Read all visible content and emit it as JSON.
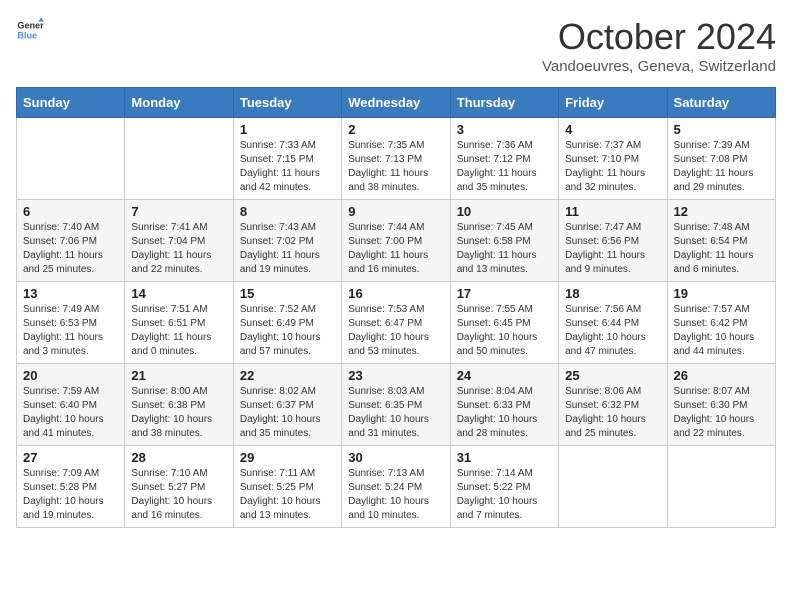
{
  "logo": {
    "line1": "General",
    "line2": "Blue"
  },
  "title": "October 2024",
  "subtitle": "Vandoeuvres, Geneva, Switzerland",
  "days_of_week": [
    "Sunday",
    "Monday",
    "Tuesday",
    "Wednesday",
    "Thursday",
    "Friday",
    "Saturday"
  ],
  "weeks": [
    [
      {
        "day": "",
        "sunrise": "",
        "sunset": "",
        "daylight": ""
      },
      {
        "day": "",
        "sunrise": "",
        "sunset": "",
        "daylight": ""
      },
      {
        "day": "1",
        "sunrise": "Sunrise: 7:33 AM",
        "sunset": "Sunset: 7:15 PM",
        "daylight": "Daylight: 11 hours and 42 minutes."
      },
      {
        "day": "2",
        "sunrise": "Sunrise: 7:35 AM",
        "sunset": "Sunset: 7:13 PM",
        "daylight": "Daylight: 11 hours and 38 minutes."
      },
      {
        "day": "3",
        "sunrise": "Sunrise: 7:36 AM",
        "sunset": "Sunset: 7:12 PM",
        "daylight": "Daylight: 11 hours and 35 minutes."
      },
      {
        "day": "4",
        "sunrise": "Sunrise: 7:37 AM",
        "sunset": "Sunset: 7:10 PM",
        "daylight": "Daylight: 11 hours and 32 minutes."
      },
      {
        "day": "5",
        "sunrise": "Sunrise: 7:39 AM",
        "sunset": "Sunset: 7:08 PM",
        "daylight": "Daylight: 11 hours and 29 minutes."
      }
    ],
    [
      {
        "day": "6",
        "sunrise": "Sunrise: 7:40 AM",
        "sunset": "Sunset: 7:06 PM",
        "daylight": "Daylight: 11 hours and 25 minutes."
      },
      {
        "day": "7",
        "sunrise": "Sunrise: 7:41 AM",
        "sunset": "Sunset: 7:04 PM",
        "daylight": "Daylight: 11 hours and 22 minutes."
      },
      {
        "day": "8",
        "sunrise": "Sunrise: 7:43 AM",
        "sunset": "Sunset: 7:02 PM",
        "daylight": "Daylight: 11 hours and 19 minutes."
      },
      {
        "day": "9",
        "sunrise": "Sunrise: 7:44 AM",
        "sunset": "Sunset: 7:00 PM",
        "daylight": "Daylight: 11 hours and 16 minutes."
      },
      {
        "day": "10",
        "sunrise": "Sunrise: 7:45 AM",
        "sunset": "Sunset: 6:58 PM",
        "daylight": "Daylight: 11 hours and 13 minutes."
      },
      {
        "day": "11",
        "sunrise": "Sunrise: 7:47 AM",
        "sunset": "Sunset: 6:56 PM",
        "daylight": "Daylight: 11 hours and 9 minutes."
      },
      {
        "day": "12",
        "sunrise": "Sunrise: 7:48 AM",
        "sunset": "Sunset: 6:54 PM",
        "daylight": "Daylight: 11 hours and 6 minutes."
      }
    ],
    [
      {
        "day": "13",
        "sunrise": "Sunrise: 7:49 AM",
        "sunset": "Sunset: 6:53 PM",
        "daylight": "Daylight: 11 hours and 3 minutes."
      },
      {
        "day": "14",
        "sunrise": "Sunrise: 7:51 AM",
        "sunset": "Sunset: 6:51 PM",
        "daylight": "Daylight: 11 hours and 0 minutes."
      },
      {
        "day": "15",
        "sunrise": "Sunrise: 7:52 AM",
        "sunset": "Sunset: 6:49 PM",
        "daylight": "Daylight: 10 hours and 57 minutes."
      },
      {
        "day": "16",
        "sunrise": "Sunrise: 7:53 AM",
        "sunset": "Sunset: 6:47 PM",
        "daylight": "Daylight: 10 hours and 53 minutes."
      },
      {
        "day": "17",
        "sunrise": "Sunrise: 7:55 AM",
        "sunset": "Sunset: 6:45 PM",
        "daylight": "Daylight: 10 hours and 50 minutes."
      },
      {
        "day": "18",
        "sunrise": "Sunrise: 7:56 AM",
        "sunset": "Sunset: 6:44 PM",
        "daylight": "Daylight: 10 hours and 47 minutes."
      },
      {
        "day": "19",
        "sunrise": "Sunrise: 7:57 AM",
        "sunset": "Sunset: 6:42 PM",
        "daylight": "Daylight: 10 hours and 44 minutes."
      }
    ],
    [
      {
        "day": "20",
        "sunrise": "Sunrise: 7:59 AM",
        "sunset": "Sunset: 6:40 PM",
        "daylight": "Daylight: 10 hours and 41 minutes."
      },
      {
        "day": "21",
        "sunrise": "Sunrise: 8:00 AM",
        "sunset": "Sunset: 6:38 PM",
        "daylight": "Daylight: 10 hours and 38 minutes."
      },
      {
        "day": "22",
        "sunrise": "Sunrise: 8:02 AM",
        "sunset": "Sunset: 6:37 PM",
        "daylight": "Daylight: 10 hours and 35 minutes."
      },
      {
        "day": "23",
        "sunrise": "Sunrise: 8:03 AM",
        "sunset": "Sunset: 6:35 PM",
        "daylight": "Daylight: 10 hours and 31 minutes."
      },
      {
        "day": "24",
        "sunrise": "Sunrise: 8:04 AM",
        "sunset": "Sunset: 6:33 PM",
        "daylight": "Daylight: 10 hours and 28 minutes."
      },
      {
        "day": "25",
        "sunrise": "Sunrise: 8:06 AM",
        "sunset": "Sunset: 6:32 PM",
        "daylight": "Daylight: 10 hours and 25 minutes."
      },
      {
        "day": "26",
        "sunrise": "Sunrise: 8:07 AM",
        "sunset": "Sunset: 6:30 PM",
        "daylight": "Daylight: 10 hours and 22 minutes."
      }
    ],
    [
      {
        "day": "27",
        "sunrise": "Sunrise: 7:09 AM",
        "sunset": "Sunset: 5:28 PM",
        "daylight": "Daylight: 10 hours and 19 minutes."
      },
      {
        "day": "28",
        "sunrise": "Sunrise: 7:10 AM",
        "sunset": "Sunset: 5:27 PM",
        "daylight": "Daylight: 10 hours and 16 minutes."
      },
      {
        "day": "29",
        "sunrise": "Sunrise: 7:11 AM",
        "sunset": "Sunset: 5:25 PM",
        "daylight": "Daylight: 10 hours and 13 minutes."
      },
      {
        "day": "30",
        "sunrise": "Sunrise: 7:13 AM",
        "sunset": "Sunset: 5:24 PM",
        "daylight": "Daylight: 10 hours and 10 minutes."
      },
      {
        "day": "31",
        "sunrise": "Sunrise: 7:14 AM",
        "sunset": "Sunset: 5:22 PM",
        "daylight": "Daylight: 10 hours and 7 minutes."
      },
      {
        "day": "",
        "sunrise": "",
        "sunset": "",
        "daylight": ""
      },
      {
        "day": "",
        "sunrise": "",
        "sunset": "",
        "daylight": ""
      }
    ]
  ]
}
